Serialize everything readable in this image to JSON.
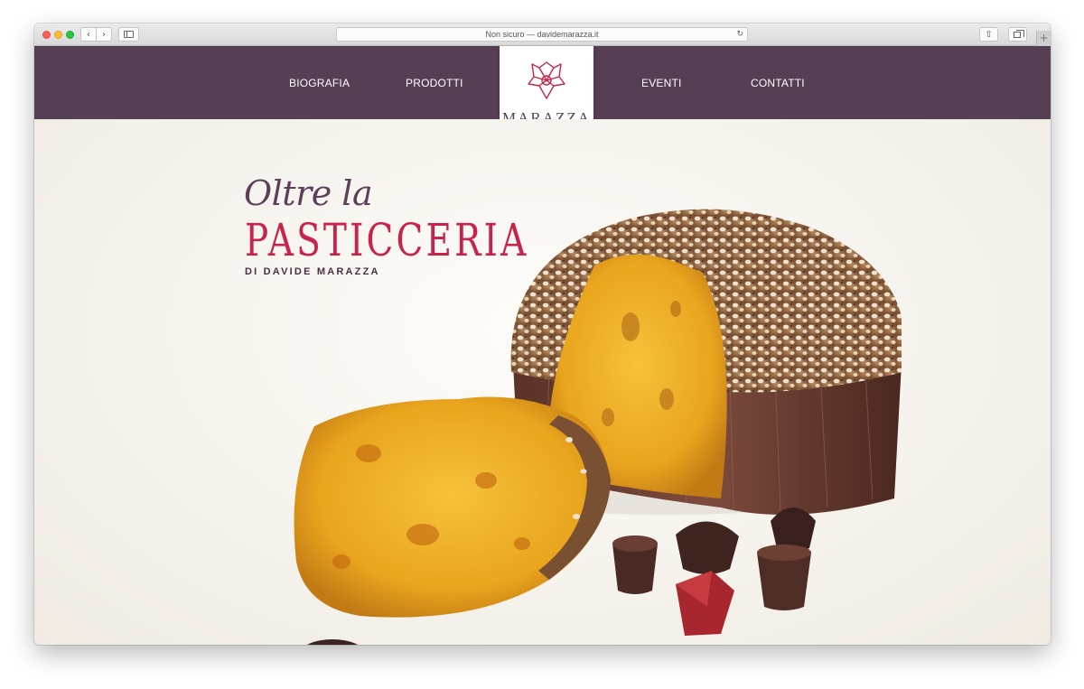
{
  "browser": {
    "address": "Non sicuro — davidemarazza.it",
    "back_glyph": "‹",
    "forward_glyph": "›",
    "reload_glyph": "↻",
    "share_glyph": "⇧",
    "newtab_glyph": "+"
  },
  "nav": {
    "items": [
      {
        "label": "BIOGRAFIA"
      },
      {
        "label": "PRODOTTI"
      },
      {
        "label": "EVENTI"
      },
      {
        "label": "CONTATTI"
      }
    ]
  },
  "logo": {
    "text": "MARAZZA"
  },
  "hero": {
    "script": "Oltre la",
    "title": "PASTICCERIA",
    "subtitle": "DI DAVIDE MARAZZA"
  },
  "colors": {
    "header": "#563e54",
    "accent": "#c8234a",
    "hero_bg": "#f5f2ec"
  }
}
